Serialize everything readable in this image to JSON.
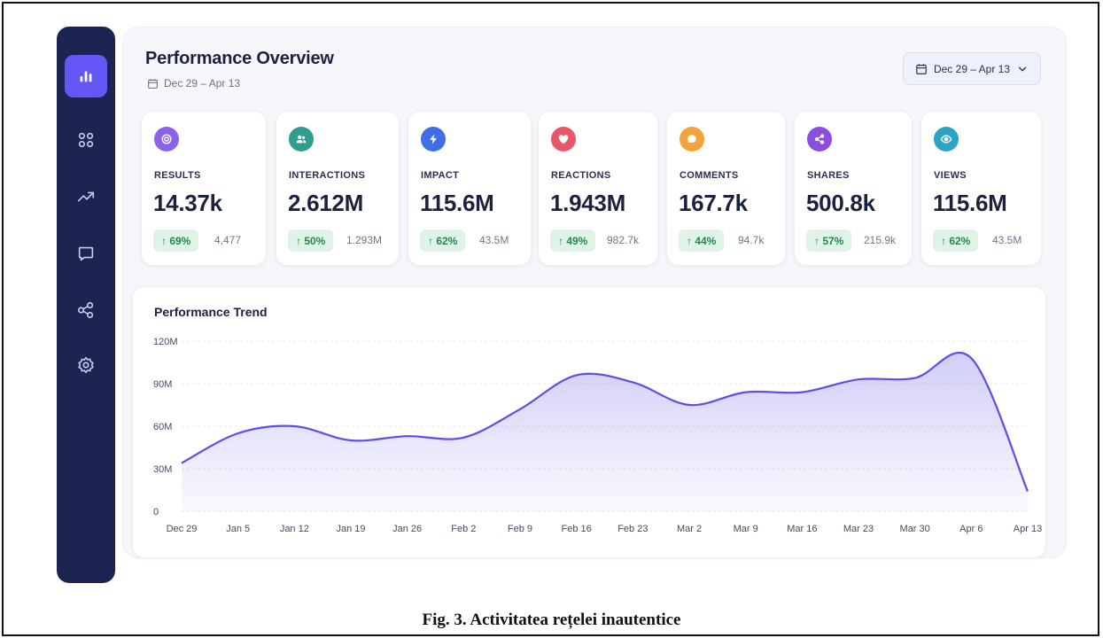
{
  "header": {
    "title": "Performance Overview",
    "date_range": "Dec 29 – Apr 13",
    "date_button": "Dec 29 – Apr 13"
  },
  "sidebar": {
    "items": [
      {
        "icon": "bar-chart-icon",
        "active": true
      },
      {
        "icon": "grid-icon",
        "active": false
      },
      {
        "icon": "trending-up-icon",
        "active": false
      },
      {
        "icon": "message-icon",
        "active": false
      },
      {
        "icon": "share-icon",
        "active": false
      },
      {
        "icon": "settings-icon",
        "active": false
      }
    ]
  },
  "cards": [
    {
      "label": "RESULTS",
      "value": "14.37k",
      "change": "↑ 69%",
      "previous": "4,477",
      "icon": "target-icon",
      "color": "#8a63ea"
    },
    {
      "label": "INTERACTIONS",
      "value": "2.612M",
      "change": "↑ 50%",
      "previous": "1.293M",
      "icon": "users-icon",
      "color": "#2f9e8f"
    },
    {
      "label": "IMPACT",
      "value": "115.6M",
      "change": "↑ 62%",
      "previous": "43.5M",
      "icon": "bolt-icon",
      "color": "#3f6fe6"
    },
    {
      "label": "REACTIONS",
      "value": "1.943M",
      "change": "↑ 49%",
      "previous": "982.7k",
      "icon": "heart-icon",
      "color": "#e8566b"
    },
    {
      "label": "COMMENTS",
      "value": "167.7k",
      "change": "↑ 44%",
      "previous": "94.7k",
      "icon": "comment-icon",
      "color": "#f4a23c"
    },
    {
      "label": "SHARES",
      "value": "500.8k",
      "change": "↑ 57%",
      "previous": "215.9k",
      "icon": "share-icon",
      "color": "#8a4fe0"
    },
    {
      "label": "VIEWS",
      "value": "115.6M",
      "change": "↑ 62%",
      "previous": "43.5M",
      "icon": "eye-icon",
      "color": "#2ba3c4"
    }
  ],
  "chart_data": {
    "type": "area",
    "title": "Performance Trend",
    "xlabel": "",
    "ylabel": "",
    "categories": [
      "Dec 29",
      "Jan 5",
      "Jan 12",
      "Jan 19",
      "Jan 26",
      "Feb 2",
      "Feb 9",
      "Feb 16",
      "Feb 23",
      "Mar 2",
      "Mar 9",
      "Mar 16",
      "Mar 23",
      "Mar 30",
      "Apr 6",
      "Apr 13"
    ],
    "series": [
      {
        "values": [
          34,
          55,
          60,
          50,
          53,
          52,
          72,
          96,
          91,
          75,
          84,
          84,
          93,
          94,
          108,
          14
        ]
      }
    ],
    "y_ticks": [
      "0",
      "30M",
      "60M",
      "90M",
      "120M"
    ],
    "ylim": [
      0,
      120
    ],
    "grid": true,
    "color": "#5b4fe6"
  },
  "caption": "Fig. 3. Activitatea rețelei inautentice",
  "colors": {
    "sidebar": "#1c2452",
    "accent": "#6557f5",
    "positive": "#1f8a4f"
  }
}
